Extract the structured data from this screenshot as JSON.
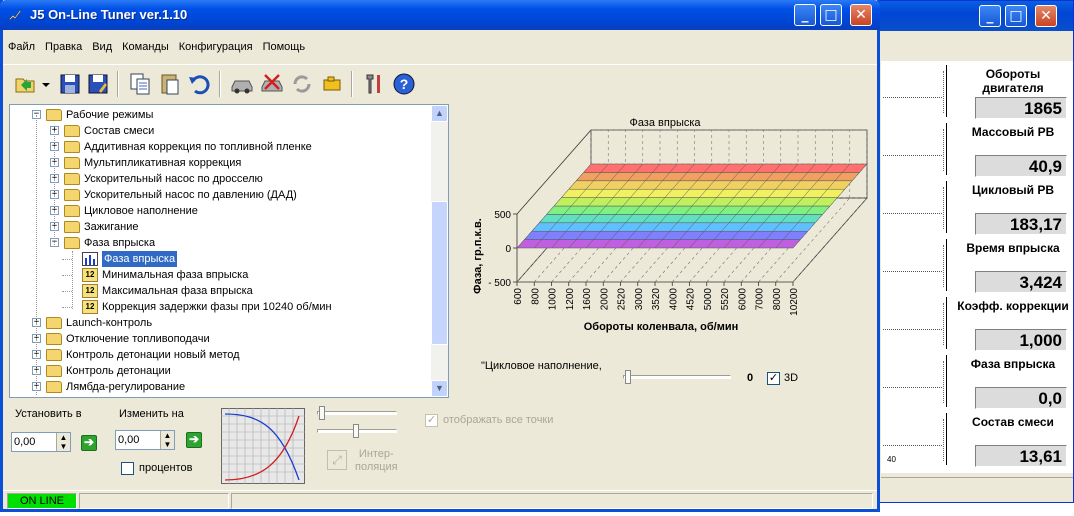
{
  "main_window": {
    "title": "J5 On-Line Tuner ver.1.10",
    "menu": [
      "Файл",
      "Правка",
      "Вид",
      "Команды",
      "Конфигурация",
      "Помощь"
    ],
    "toolbar_icons": [
      "open-icon",
      "dropdown-arrow-icon",
      "save-icon",
      "save-as-icon",
      "copy-icon",
      "paste-icon",
      "undo-icon",
      "car-read-icon",
      "car-write-icon",
      "refresh-icon",
      "engine-icon",
      "tools-icon",
      "help-icon"
    ]
  },
  "tree": {
    "items": [
      {
        "label": "Рабочие режимы",
        "level": 1,
        "kind": "folder-open",
        "expander": "−"
      },
      {
        "label": "Состав смеси",
        "level": 2,
        "kind": "folder",
        "expander": "+"
      },
      {
        "label": "Аддитивная коррекция по топливной пленке",
        "level": 2,
        "kind": "folder",
        "expander": "+"
      },
      {
        "label": "Мультипликативная коррекция",
        "level": 2,
        "kind": "folder",
        "expander": "+"
      },
      {
        "label": "Ускорительный насос по дросселю",
        "level": 2,
        "kind": "folder",
        "expander": "+"
      },
      {
        "label": "Ускорительный насос по давлению (ДАД)",
        "level": 2,
        "kind": "folder",
        "expander": "+"
      },
      {
        "label": "Цикловое наполнение",
        "level": 2,
        "kind": "folder",
        "expander": "+"
      },
      {
        "label": "Зажигание",
        "level": 2,
        "kind": "folder",
        "expander": "+"
      },
      {
        "label": "Фаза впрыска",
        "level": 2,
        "kind": "folder-open",
        "expander": "−"
      },
      {
        "label": "Фаза впрыска",
        "level": 3,
        "kind": "chart",
        "expander": "",
        "selected": true
      },
      {
        "label": "Минимальная фаза впрыска",
        "level": 3,
        "kind": "num12",
        "expander": ""
      },
      {
        "label": "Максимальная фаза впрыска",
        "level": 3,
        "kind": "num12",
        "expander": ""
      },
      {
        "label": "Коррекция задержки фазы при 10240 об/мин",
        "level": 3,
        "kind": "num12",
        "expander": ""
      },
      {
        "label": "Launch-контроль",
        "level": 1,
        "kind": "folder",
        "expander": "+"
      },
      {
        "label": "Отключение топливоподачи",
        "level": 1,
        "kind": "folder",
        "expander": "+"
      },
      {
        "label": "Контроль детонации новый метод",
        "level": 1,
        "kind": "folder",
        "expander": "+"
      },
      {
        "label": "Контроль детонации",
        "level": 1,
        "kind": "folder",
        "expander": "+"
      },
      {
        "label": "Лямбда-регулирование",
        "level": 1,
        "kind": "folder",
        "expander": "+"
      }
    ]
  },
  "chart_data": {
    "type": "surface3d",
    "title": "Фаза впрыска",
    "xlabel": "Обороты коленвала, об/мин",
    "ylabel": "Фаза, гр.п.к.в.",
    "x_ticks": [
      "600",
      "800",
      "1000",
      "1200",
      "1600",
      "2000",
      "2520",
      "3000",
      "3520",
      "4000",
      "4520",
      "5000",
      "5520",
      "6000",
      "7000",
      "8000",
      "10200"
    ],
    "z_ticks": [
      "500",
      "0",
      "- 500"
    ],
    "zlim": [
      -500,
      500
    ],
    "surface_value": 0,
    "band_colors": [
      "#c060e0",
      "#8080ff",
      "#60c0ff",
      "#60e0c0",
      "#80f080",
      "#c0f060",
      "#f0f060",
      "#f0d060",
      "#f0a060",
      "#ff7070"
    ]
  },
  "chart_controls": {
    "slider_label": "\"Цикловое наполнение,",
    "slider_value": "0",
    "checkbox_3d_label": "3D",
    "checkbox_3d_checked": true
  },
  "bottom": {
    "set_to_label": "Установить в",
    "set_to_value": "0,00",
    "change_by_label": "Изменить на",
    "change_by_value": "0,00",
    "percent_label": "процентов",
    "interp_label": "Интер-\nполяция",
    "show_all_points_label": "отображать все точки"
  },
  "status": {
    "online": "ON LINE",
    "online_color": "#00e000"
  },
  "monitor": {
    "axis_label": "40",
    "gauges": [
      {
        "label": "Обороты двигателя",
        "value": "1865"
      },
      {
        "label": "Массовый РВ",
        "value": "40,9"
      },
      {
        "label": "Цикловый РВ",
        "value": "183,17"
      },
      {
        "label": "Время впрыска",
        "value": "3,424"
      },
      {
        "label": "Коэфф. коррекции",
        "value": "1,000"
      },
      {
        "label": "Фаза впрыска",
        "value": "0,0"
      },
      {
        "label": "Состав смеси",
        "value": "13,61"
      }
    ]
  }
}
